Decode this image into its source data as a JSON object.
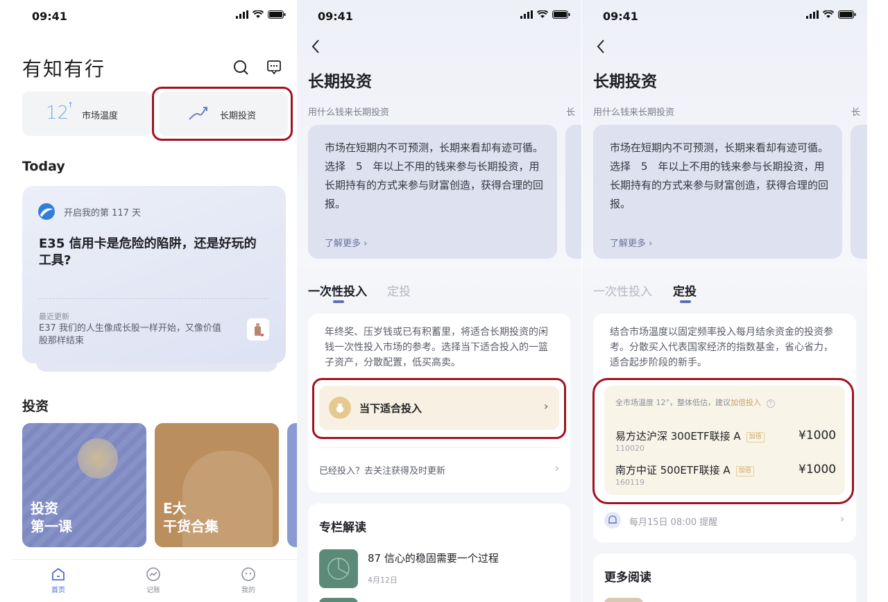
{
  "status": {
    "time": "09:41"
  },
  "home": {
    "app_title": "有知有行",
    "market_temp": {
      "value": "12",
      "label": "市场温度"
    },
    "long_term": {
      "label": "长期投资"
    },
    "today_heading": "Today",
    "today_card": {
      "day_text": "开启我的第 117 天",
      "headline": "E35 信用卡是危险的陷阱，还是好玩的工具?",
      "recent_label": "最近更新",
      "recent_text": "E37 我们的人生像成长股一样开始，又像价值股那样结束"
    },
    "invest_heading": "投资",
    "invest_cards": [
      {
        "line1": "投资",
        "line2": "第一课"
      },
      {
        "line1": "E大",
        "line2": "干货合集"
      }
    ],
    "bottom_nav": [
      {
        "label": "首页",
        "icon": "home-icon"
      },
      {
        "label": "记账",
        "icon": "chart-circle-icon"
      },
      {
        "label": "我的",
        "icon": "profile-icon"
      }
    ]
  },
  "detail": {
    "page_title": "长期投资",
    "section_label": "用什么钱来长期投资",
    "section_label_peek": "长",
    "intro": "市场在短期内不可预测，长期来看却有迹可循。选择　5　年以上不用的钱来参与长期投资，用长期持有的方式来参与财富创造，获得合理的回报。",
    "learn_more": "了解更多",
    "tabs": [
      "一次性投入",
      "定投"
    ],
    "lump_sum": {
      "desc": "年终奖、压岁钱或已有积蓄里，将适合长期投资的闲钱一次性投入市场的参考。选择当下适合投入的一篮子资产，分散配置，低买高卖。",
      "cta": "当下适合投入",
      "follow_text": "已经投入？去关注获得及时更新"
    },
    "column_heading": "专栏解读",
    "column_item": {
      "title": "87 信心的稳固需要一个过程",
      "date": "4月12日"
    },
    "dca": {
      "desc": "结合市场温度以固定频率投入每月结余资金的投资参考。分散买入代表国家经济的指数基金，省心省力，适合起步阶段的新手。",
      "summary_prefix": "全市场温度 12°，整体低估，建议",
      "summary_highlight": "加倍投入",
      "funds": [
        {
          "name": "易方达沪深 300ETF联接 A",
          "tag": "加倍",
          "code": "110020",
          "amount": "¥1000"
        },
        {
          "name": "南方中证 500ETF联接 A",
          "tag": "加倍",
          "code": "160119",
          "amount": "¥1000"
        }
      ],
      "reminder": "每月15日 08:00 提醒"
    },
    "more_reading": "更多阅读"
  },
  "colors": {
    "accent": "#5f6fb5",
    "highlight_outline": "#a3101f",
    "gold": "#c9a060"
  }
}
